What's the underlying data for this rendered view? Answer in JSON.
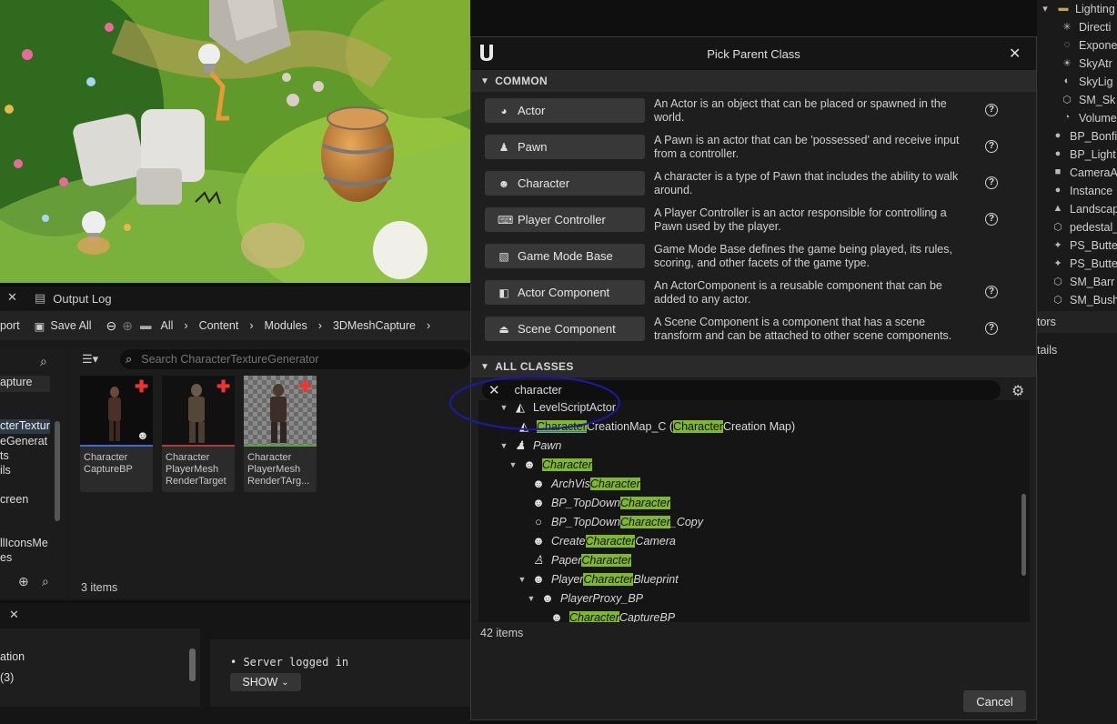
{
  "dialog": {
    "title": "Pick Parent Class",
    "common_header": "COMMON",
    "all_classes_header": "ALL CLASSES",
    "common_classes": [
      {
        "label": "Actor",
        "icon": "actor-icon",
        "description": "An Actor is an object that can be placed or spawned in the world."
      },
      {
        "label": "Pawn",
        "icon": "pawn-icon",
        "description": "A Pawn is an actor that can be 'possessed' and receive input from a controller."
      },
      {
        "label": "Character",
        "icon": "character-icon",
        "description": "A character is a type of Pawn that includes the ability to walk around."
      },
      {
        "label": "Player Controller",
        "icon": "gamepad-icon",
        "description": "A Player Controller is an actor responsible for controlling a Pawn used by the player."
      },
      {
        "label": "Game Mode Base",
        "icon": "image-icon",
        "description": "Game Mode Base defines the game being played, its rules, scoring, and other facets of the game type."
      },
      {
        "label": "Actor Component",
        "icon": "component-icon",
        "description": "An ActorComponent is a reusable component that can be added to any actor."
      },
      {
        "label": "Scene Component",
        "icon": "scene-component-icon",
        "description": "A Scene Component is a component that has a scene transform and can be attached to other scene components."
      }
    ],
    "search_value": "character",
    "tree": [
      {
        "pre": "LevelScriptActor",
        "hl": "",
        "post": ""
      },
      {
        "pre": "",
        "hl": "Character",
        "post": "CreationMap_C (",
        "hl2": "Character",
        "post2": " Creation Map)"
      },
      {
        "pre": "Pawn",
        "hl": "",
        "post": ""
      },
      {
        "pre": "",
        "hl": "Character",
        "post": ""
      },
      {
        "pre": "ArchVis",
        "hl": "Character",
        "post": ""
      },
      {
        "pre": "BP_TopDown",
        "hl": "Character",
        "post": ""
      },
      {
        "pre": "BP_TopDown",
        "hl": "Character",
        "post": "_Copy"
      },
      {
        "pre": "Create",
        "hl": "Character",
        "post": "Camera"
      },
      {
        "pre": "Paper",
        "hl": "Character",
        "post": ""
      },
      {
        "pre": "Player",
        "hl": "Character",
        "post": "Blueprint"
      },
      {
        "pre": "PlayerProxy_BP",
        "hl": "",
        "post": ""
      },
      {
        "pre": "",
        "hl": "Character",
        "post": "CaptureBP"
      }
    ],
    "item_count": "42 items",
    "cancel_label": "Cancel"
  },
  "content_browser": {
    "tab_label": "Output Log",
    "import_label": "port",
    "save_all_label": "Save All",
    "breadcrumb": [
      "All",
      "Content",
      "Modules",
      "3DMeshCapture"
    ],
    "search_placeholder": "Search CharacterTextureGenerator",
    "left_tree": [
      "apture",
      "cterTextur",
      "eGenerat",
      "ts",
      "ils",
      "creen",
      "llIconsMe",
      "es"
    ],
    "assets": [
      {
        "label": "Character CaptureBP"
      },
      {
        "label": "Character PlayerMesh RenderTarget"
      },
      {
        "label": "Character PlayerMesh RenderTArg..."
      }
    ],
    "asset_count": "3 items"
  },
  "bottom_panel": {
    "left_items": [
      "ation",
      "(3)"
    ],
    "log_line": "Server logged in",
    "show_label": "SHOW"
  },
  "outliner": {
    "items": [
      "Lighting",
      "Directi",
      "Expone",
      "SkyAtr",
      "SkyLig",
      "SM_Sk",
      "Volume",
      "BP_Bonfi",
      "BP_Light",
      "CameraA",
      "Instance",
      "Landscap",
      "pedestal_",
      "PS_Butte",
      "PS_Butte",
      "SM_Barr",
      "SM_Bush"
    ],
    "tab_label": "tors",
    "details_label": "tails"
  },
  "colors": {
    "highlight": "#7fb82e",
    "annotation_circle": "#1a1aa8",
    "asset_underline_blue": "#3a6bd6",
    "asset_underline_red": "#b33a3a",
    "asset_underline_green": "#52a83a"
  }
}
